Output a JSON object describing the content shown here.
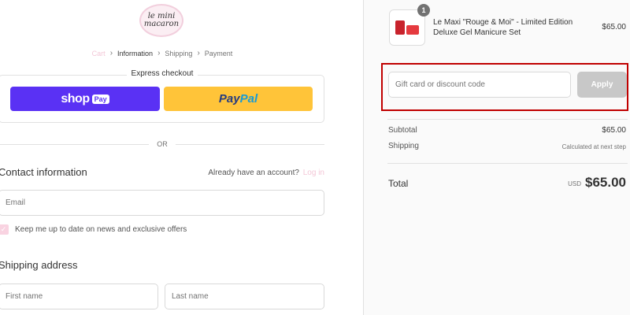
{
  "brand": {
    "logo_line1": "le mini",
    "logo_line2": "macaron"
  },
  "breadcrumb": {
    "cart": "Cart",
    "information": "Information",
    "shipping": "Shipping",
    "payment": "Payment"
  },
  "express": {
    "title": "Express checkout",
    "shop_label": "shop",
    "shop_pay_pill": "Pay",
    "paypal_part1": "Pay",
    "paypal_part2": "Pal"
  },
  "divider": {
    "or_label": "OR"
  },
  "contact": {
    "title": "Contact information",
    "account_prompt": "Already have an account?",
    "login_link": "Log in",
    "email_placeholder": "Email",
    "newsletter_label": "Keep me up to date on news and exclusive offers",
    "newsletter_checked": true
  },
  "shipping_address": {
    "title": "Shipping address",
    "first_name_placeholder": "First name",
    "last_name_placeholder": "Last name"
  },
  "order": {
    "item": {
      "quantity": "1",
      "name": "Le Maxi \"Rouge & Moi\" - Limited Edition Deluxe Gel Manicure Set",
      "price": "$65.00"
    },
    "discount_placeholder": "Gift card or discount code",
    "apply_label": "Apply",
    "subtotal_label": "Subtotal",
    "subtotal_value": "$65.00",
    "shipping_label": "Shipping",
    "shipping_value": "Calculated at next step",
    "total_label": "Total",
    "total_currency": "USD",
    "total_value": "$65.00"
  },
  "colors": {
    "shop_pay": "#5a31f4",
    "paypal": "#ffc439",
    "accent_pink": "#f3c7d7",
    "highlight_frame": "#c00000"
  }
}
